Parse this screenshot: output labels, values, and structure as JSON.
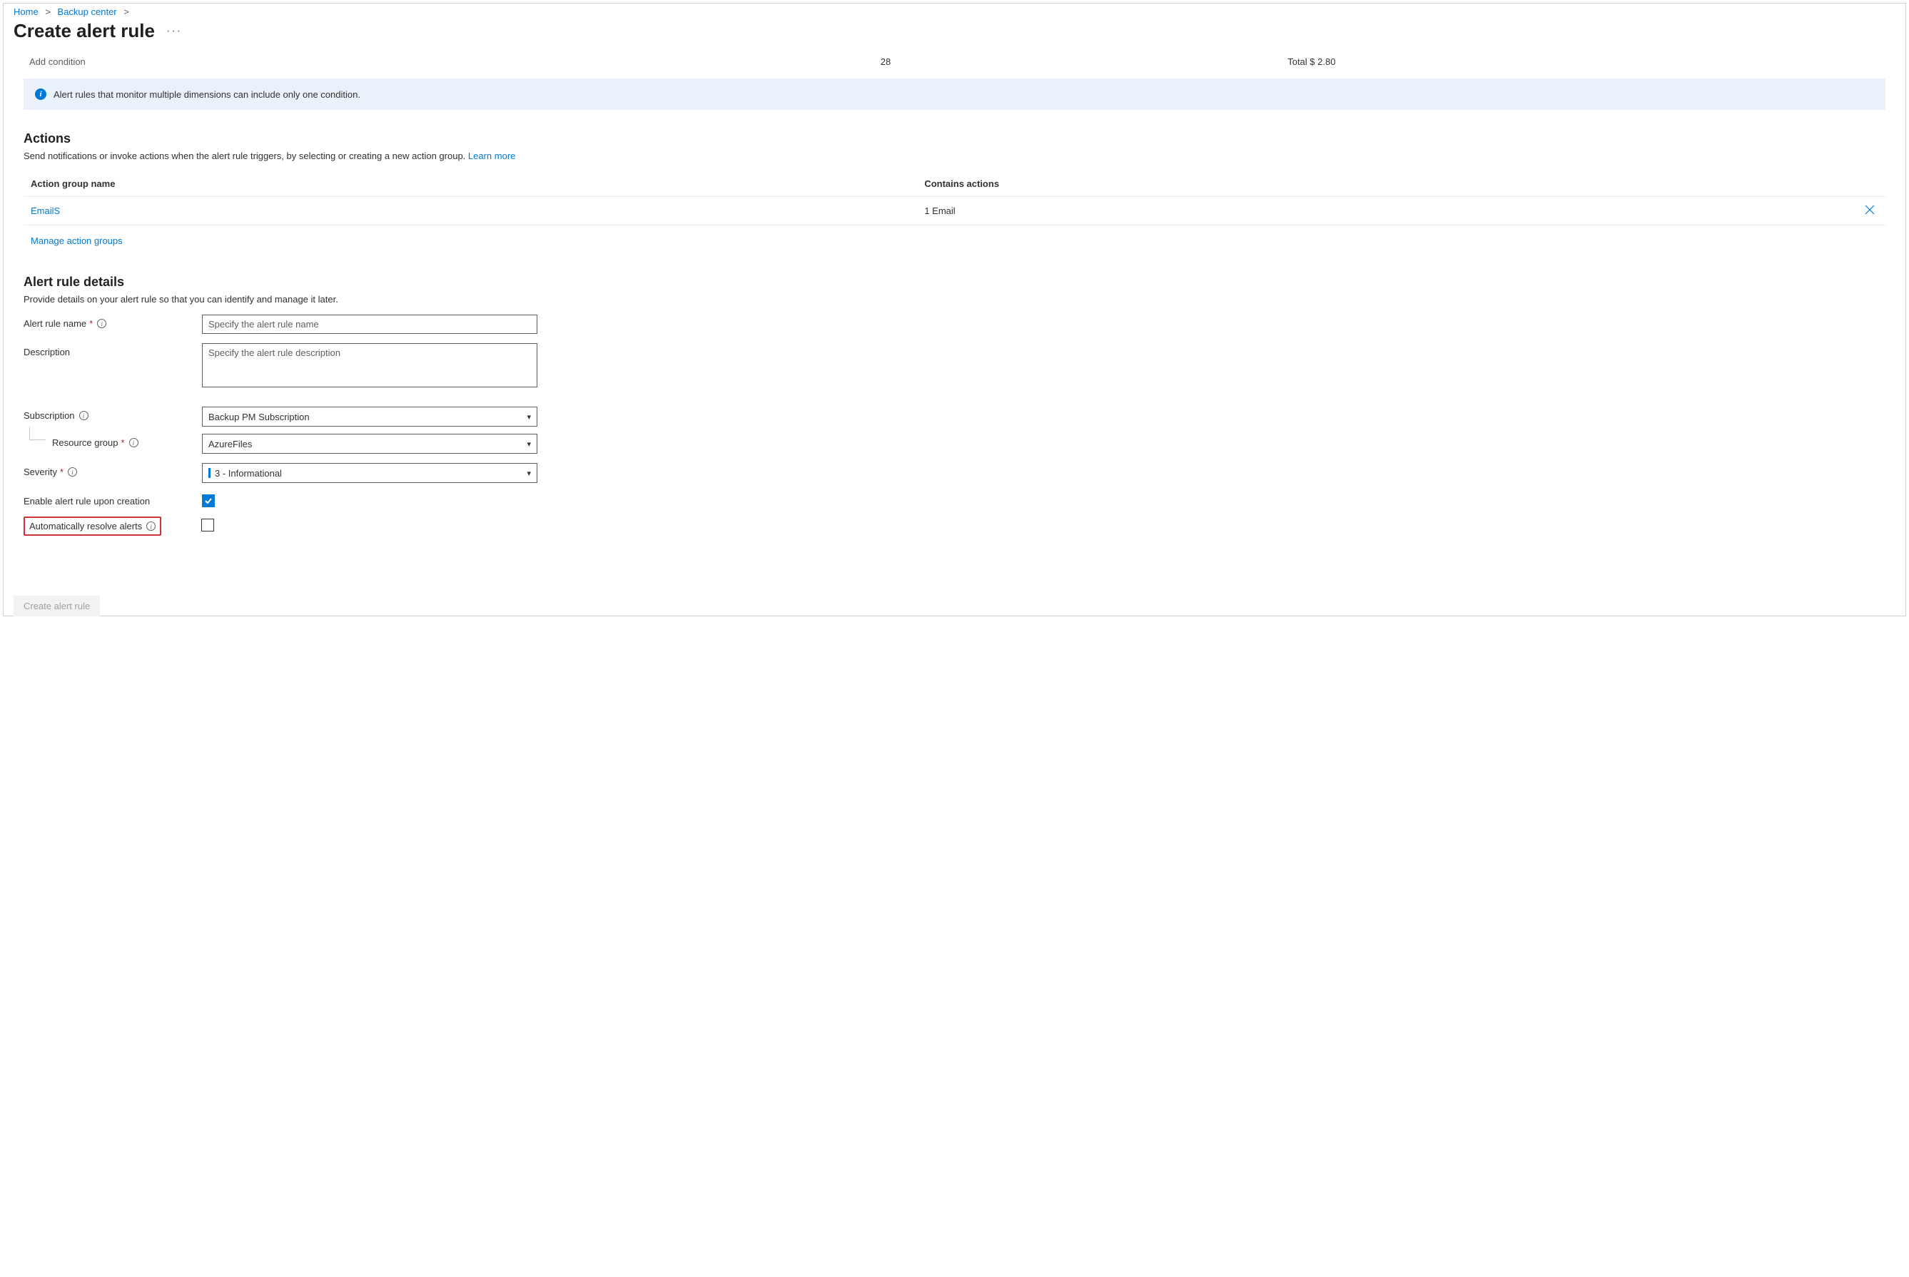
{
  "breadcrumb": {
    "home": "Home",
    "backup_center": "Backup center"
  },
  "title": "Create alert rule",
  "condition": {
    "add_label": "Add condition",
    "count": "28",
    "total": "Total $ 2.80"
  },
  "info_banner": "Alert rules that monitor multiple dimensions can include only one condition.",
  "actions": {
    "heading": "Actions",
    "description": "Send notifications or invoke actions when the alert rule triggers, by selecting or creating a new action group. ",
    "learn_more": "Learn more",
    "columns": {
      "name": "Action group name",
      "contains": "Contains actions"
    },
    "rows": [
      {
        "name": "EmailS",
        "contains": "1 Email"
      }
    ],
    "manage": "Manage action groups"
  },
  "details": {
    "heading": "Alert rule details",
    "description": "Provide details on your alert rule so that you can identify and manage it later.",
    "labels": {
      "alert_rule_name": "Alert rule name",
      "description": "Description",
      "subscription": "Subscription",
      "resource_group": "Resource group",
      "severity": "Severity",
      "enable": "Enable alert rule upon creation",
      "auto_resolve": "Automatically resolve alerts"
    },
    "placeholders": {
      "name": "Specify the alert rule name",
      "description": "Specify the alert rule description"
    },
    "values": {
      "subscription": "Backup PM Subscription",
      "resource_group": "AzureFiles",
      "severity": "3 - Informational"
    }
  },
  "footer": {
    "create": "Create alert rule"
  }
}
